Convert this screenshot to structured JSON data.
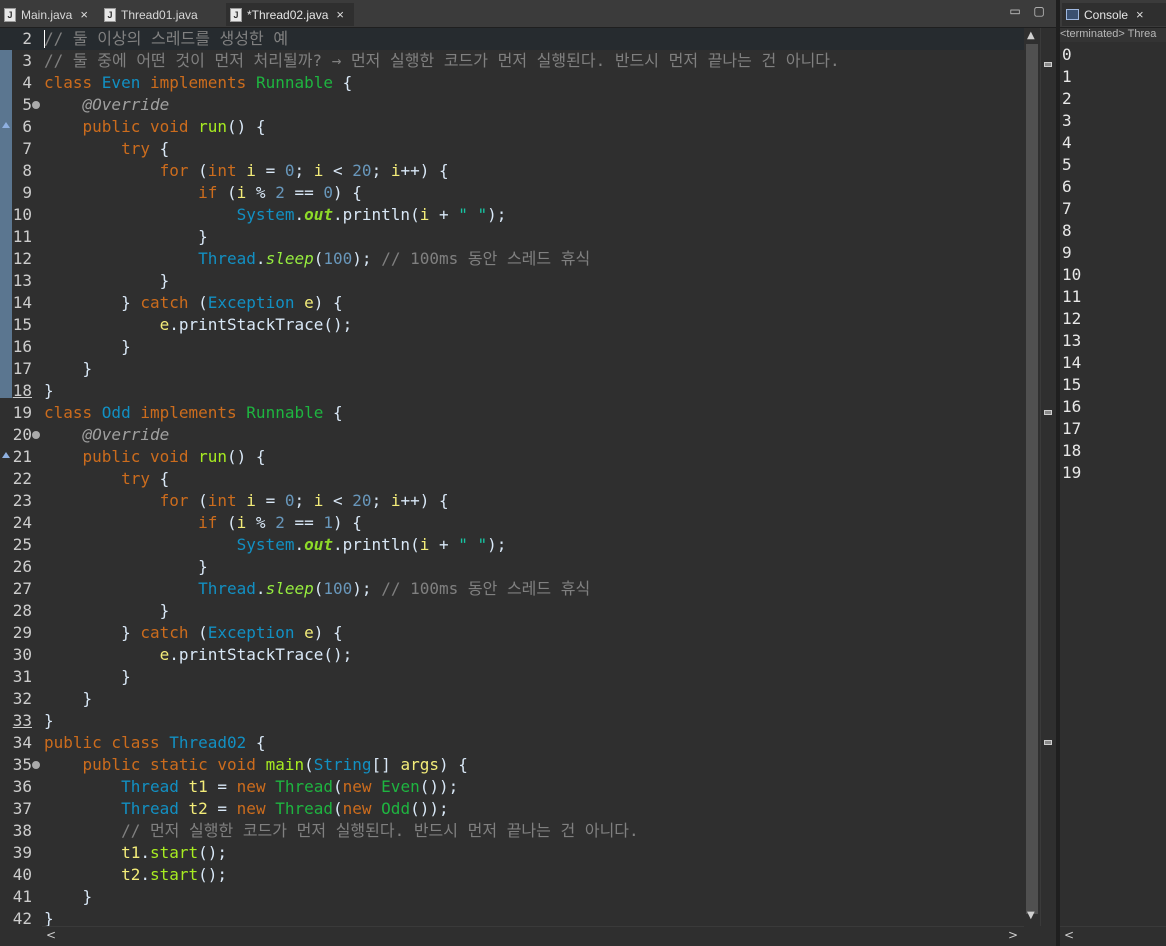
{
  "tabs": [
    {
      "label": "Main.java",
      "icon": "java-file-icon",
      "close": "×"
    },
    {
      "label": "Thread01.java",
      "icon": "java-file-icon",
      "close": ""
    },
    {
      "label": "*Thread02.java",
      "icon": "java-file-icon",
      "close": "×"
    }
  ],
  "window_controls": {
    "minimize": "▭",
    "maximize": "▢"
  },
  "console": {
    "tab_label": "Console",
    "close": "×",
    "status": "<terminated> Threa",
    "output": [
      "0",
      "1",
      "2",
      "3",
      "4",
      "5",
      "6",
      "7",
      "8",
      "9",
      "10",
      "11",
      "12",
      "13",
      "14",
      "15",
      "16",
      "17",
      "18",
      "19"
    ]
  },
  "editor_lines": [
    {
      "n": "2",
      "segs": [
        [
          "// 둘 이상의 스레드를 생성한 예",
          "cm"
        ]
      ]
    },
    {
      "n": "3",
      "segs": [
        [
          "// 둘 중에 어떤 것이 먼저 처리될까? → 먼저 실행한 코드가 먼저 실행된다. 반드시 먼저 끝나는 건 아니다.",
          "cm"
        ]
      ]
    },
    {
      "n": "4",
      "segs": [
        [
          "class ",
          "k"
        ],
        [
          "Even ",
          "t"
        ],
        [
          "implements ",
          "k"
        ],
        [
          "Runnable",
          "tn"
        ],
        [
          " {",
          ""
        ]
      ]
    },
    {
      "n": "5",
      "fold": true,
      "segs": [
        [
          "    ",
          ""
        ],
        [
          "@Override",
          "an"
        ]
      ]
    },
    {
      "n": "6",
      "ovr": true,
      "segs": [
        [
          "    ",
          ""
        ],
        [
          "public void ",
          "k"
        ],
        [
          "run",
          "m"
        ],
        [
          "() {",
          ""
        ]
      ]
    },
    {
      "n": "7",
      "segs": [
        [
          "        ",
          ""
        ],
        [
          "try",
          "k"
        ],
        [
          " {",
          ""
        ]
      ]
    },
    {
      "n": "8",
      "segs": [
        [
          "            ",
          ""
        ],
        [
          "for",
          "k"
        ],
        [
          " (",
          ""
        ],
        [
          "int ",
          "k"
        ],
        [
          "i",
          "vr"
        ],
        [
          " = ",
          ""
        ],
        [
          "0",
          "num"
        ],
        [
          "; ",
          ""
        ],
        [
          "i",
          "vr"
        ],
        [
          " < ",
          ""
        ],
        [
          "20",
          "num"
        ],
        [
          "; ",
          ""
        ],
        [
          "i",
          "vr"
        ],
        [
          "++) {",
          ""
        ]
      ]
    },
    {
      "n": "9",
      "segs": [
        [
          "                ",
          ""
        ],
        [
          "if",
          "k"
        ],
        [
          " (",
          ""
        ],
        [
          "i",
          "vr"
        ],
        [
          " % ",
          ""
        ],
        [
          "2",
          "num"
        ],
        [
          " == ",
          ""
        ],
        [
          "0",
          "num"
        ],
        [
          ") {",
          ""
        ]
      ]
    },
    {
      "n": "10",
      "segs": [
        [
          "                    ",
          ""
        ],
        [
          "System",
          "t"
        ],
        [
          ".",
          ""
        ],
        [
          "out",
          "st"
        ],
        [
          ".println(",
          ""
        ],
        [
          "i",
          "vr"
        ],
        [
          " + ",
          ""
        ],
        [
          "\" \"",
          "str"
        ],
        [
          ");",
          ""
        ]
      ]
    },
    {
      "n": "11",
      "segs": [
        [
          "                }",
          ""
        ]
      ]
    },
    {
      "n": "12",
      "segs": [
        [
          "                ",
          ""
        ],
        [
          "Thread",
          "t"
        ],
        [
          ".",
          ""
        ],
        [
          "sleep",
          "sm"
        ],
        [
          "(",
          ""
        ],
        [
          "100",
          "num"
        ],
        [
          "); ",
          ""
        ],
        [
          "// 100ms 동안 스레드 휴식",
          "cm"
        ]
      ]
    },
    {
      "n": "13",
      "segs": [
        [
          "            }",
          ""
        ]
      ]
    },
    {
      "n": "14",
      "segs": [
        [
          "        } ",
          ""
        ],
        [
          "catch",
          "k"
        ],
        [
          " (",
          ""
        ],
        [
          "Exception ",
          "t"
        ],
        [
          "e",
          "vr"
        ],
        [
          ") {",
          ""
        ]
      ]
    },
    {
      "n": "15",
      "segs": [
        [
          "            ",
          ""
        ],
        [
          "e",
          "vr"
        ],
        [
          ".printStackTrace();",
          ""
        ]
      ]
    },
    {
      "n": "16",
      "segs": [
        [
          "        }",
          ""
        ]
      ]
    },
    {
      "n": "17",
      "segs": [
        [
          "    }",
          ""
        ]
      ]
    },
    {
      "n": "18",
      "ul": true,
      "segs": [
        [
          "}",
          ""
        ]
      ]
    },
    {
      "n": "19",
      "segs": [
        [
          "class ",
          "k"
        ],
        [
          "Odd ",
          "t"
        ],
        [
          "implements ",
          "k"
        ],
        [
          "Runnable",
          "tn"
        ],
        [
          " {",
          ""
        ]
      ]
    },
    {
      "n": "20",
      "fold": true,
      "segs": [
        [
          "    ",
          ""
        ],
        [
          "@Override",
          "an"
        ]
      ]
    },
    {
      "n": "21",
      "ovr": true,
      "segs": [
        [
          "    ",
          ""
        ],
        [
          "public void ",
          "k"
        ],
        [
          "run",
          "m"
        ],
        [
          "() {",
          ""
        ]
      ]
    },
    {
      "n": "22",
      "segs": [
        [
          "        ",
          ""
        ],
        [
          "try",
          "k"
        ],
        [
          " {",
          ""
        ]
      ]
    },
    {
      "n": "23",
      "segs": [
        [
          "            ",
          ""
        ],
        [
          "for",
          "k"
        ],
        [
          " (",
          ""
        ],
        [
          "int ",
          "k"
        ],
        [
          "i",
          "vr"
        ],
        [
          " = ",
          ""
        ],
        [
          "0",
          "num"
        ],
        [
          "; ",
          ""
        ],
        [
          "i",
          "vr"
        ],
        [
          " < ",
          ""
        ],
        [
          "20",
          "num"
        ],
        [
          "; ",
          ""
        ],
        [
          "i",
          "vr"
        ],
        [
          "++) {",
          ""
        ]
      ]
    },
    {
      "n": "24",
      "segs": [
        [
          "                ",
          ""
        ],
        [
          "if",
          "k"
        ],
        [
          " (",
          ""
        ],
        [
          "i",
          "vr"
        ],
        [
          " % ",
          ""
        ],
        [
          "2",
          "num"
        ],
        [
          " == ",
          ""
        ],
        [
          "1",
          "num"
        ],
        [
          ") {",
          ""
        ]
      ]
    },
    {
      "n": "25",
      "segs": [
        [
          "                    ",
          ""
        ],
        [
          "System",
          "t"
        ],
        [
          ".",
          ""
        ],
        [
          "out",
          "st"
        ],
        [
          ".println(",
          ""
        ],
        [
          "i",
          "vr"
        ],
        [
          " + ",
          ""
        ],
        [
          "\" \"",
          "str"
        ],
        [
          ");",
          ""
        ]
      ]
    },
    {
      "n": "26",
      "segs": [
        [
          "                }",
          ""
        ]
      ]
    },
    {
      "n": "27",
      "segs": [
        [
          "                ",
          ""
        ],
        [
          "Thread",
          "t"
        ],
        [
          ".",
          ""
        ],
        [
          "sleep",
          "sm"
        ],
        [
          "(",
          ""
        ],
        [
          "100",
          "num"
        ],
        [
          "); ",
          ""
        ],
        [
          "// 100ms 동안 스레드 휴식",
          "cm"
        ]
      ]
    },
    {
      "n": "28",
      "segs": [
        [
          "            }",
          ""
        ]
      ]
    },
    {
      "n": "29",
      "segs": [
        [
          "        } ",
          ""
        ],
        [
          "catch",
          "k"
        ],
        [
          " (",
          ""
        ],
        [
          "Exception ",
          "t"
        ],
        [
          "e",
          "vr"
        ],
        [
          ") {",
          ""
        ]
      ]
    },
    {
      "n": "30",
      "segs": [
        [
          "            ",
          ""
        ],
        [
          "e",
          "vr"
        ],
        [
          ".printStackTrace();",
          ""
        ]
      ]
    },
    {
      "n": "31",
      "segs": [
        [
          "        }",
          ""
        ]
      ]
    },
    {
      "n": "32",
      "segs": [
        [
          "    }",
          ""
        ]
      ]
    },
    {
      "n": "33",
      "ul": true,
      "segs": [
        [
          "}",
          ""
        ]
      ]
    },
    {
      "n": "34",
      "segs": [
        [
          "public class ",
          "k"
        ],
        [
          "Thread02",
          "t"
        ],
        [
          " {",
          ""
        ]
      ]
    },
    {
      "n": "35",
      "fold": true,
      "segs": [
        [
          "    ",
          ""
        ],
        [
          "public static void ",
          "k"
        ],
        [
          "main",
          "m"
        ],
        [
          "(",
          ""
        ],
        [
          "String",
          "t"
        ],
        [
          "[] ",
          ""
        ],
        [
          "args",
          "vr"
        ],
        [
          ") {",
          ""
        ]
      ]
    },
    {
      "n": "36",
      "segs": [
        [
          "        ",
          ""
        ],
        [
          "Thread ",
          "t"
        ],
        [
          "t1",
          "vr"
        ],
        [
          " = ",
          ""
        ],
        [
          "new ",
          "k"
        ],
        [
          "Thread",
          "tn"
        ],
        [
          "(",
          ""
        ],
        [
          "new ",
          "k"
        ],
        [
          "Even",
          "tn"
        ],
        [
          "());",
          ""
        ]
      ]
    },
    {
      "n": "37",
      "segs": [
        [
          "        ",
          ""
        ],
        [
          "Thread ",
          "t"
        ],
        [
          "t2",
          "vr"
        ],
        [
          " = ",
          ""
        ],
        [
          "new ",
          "k"
        ],
        [
          "Thread",
          "tn"
        ],
        [
          "(",
          ""
        ],
        [
          "new ",
          "k"
        ],
        [
          "Odd",
          "tn"
        ],
        [
          "());",
          ""
        ]
      ]
    },
    {
      "n": "38",
      "segs": [
        [
          "        ",
          ""
        ],
        [
          "// 먼저 실행한 코드가 먼저 실행된다. 반드시 먼저 끝나는 건 아니다.",
          "cm"
        ]
      ]
    },
    {
      "n": "39",
      "segs": [
        [
          "        ",
          ""
        ],
        [
          "t1",
          "vr"
        ],
        [
          ".",
          ""
        ],
        [
          "start",
          "m"
        ],
        [
          "();",
          ""
        ]
      ]
    },
    {
      "n": "40",
      "segs": [
        [
          "        ",
          ""
        ],
        [
          "t2",
          "vr"
        ],
        [
          ".",
          ""
        ],
        [
          "start",
          "m"
        ],
        [
          "();",
          ""
        ]
      ]
    },
    {
      "n": "41",
      "segs": [
        [
          "    }",
          ""
        ]
      ]
    },
    {
      "n": "42",
      "segs": [
        [
          "}",
          ""
        ]
      ]
    }
  ],
  "scroll": {
    "up": "▲",
    "down": "▼",
    "left": "<",
    "right": ">"
  }
}
